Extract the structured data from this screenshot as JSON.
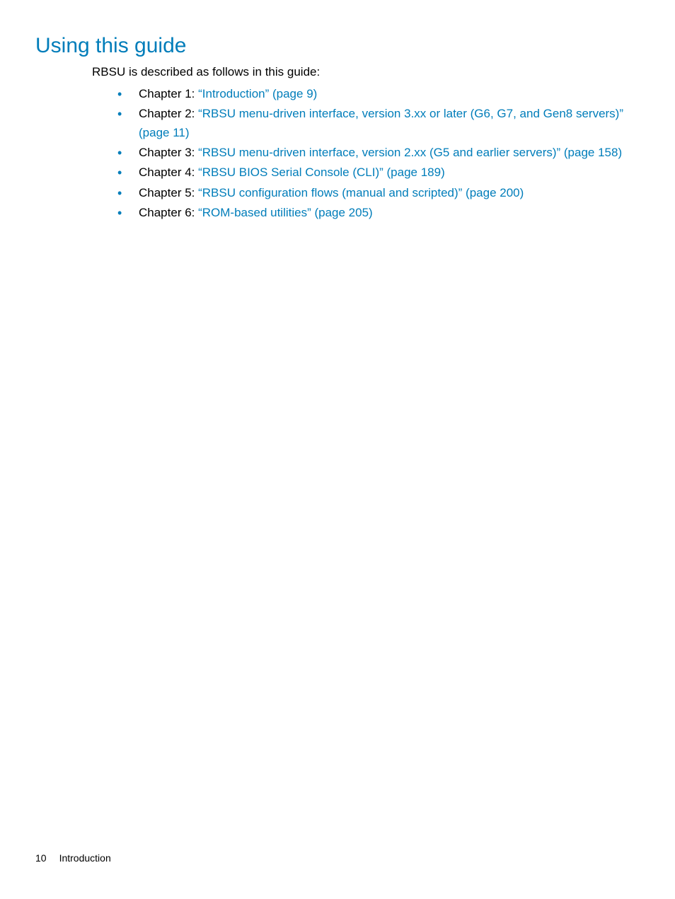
{
  "heading": "Using this guide",
  "intro": "RBSU is described as follows in this guide:",
  "chapters": [
    {
      "prefix": "Chapter 1: ",
      "link": "“Introduction” (page 9)"
    },
    {
      "prefix": "Chapter 2: ",
      "link": "“RBSU menu-driven interface, version 3.xx or later (G6, G7, and Gen8 servers)” (page 11)"
    },
    {
      "prefix": "Chapter 3: ",
      "link": "“RBSU menu-driven interface, version 2.xx (G5 and earlier servers)” (page 158)"
    },
    {
      "prefix": "Chapter 4: ",
      "link": "“RBSU BIOS Serial Console (CLI)” (page 189)"
    },
    {
      "prefix": "Chapter 5: ",
      "link": "“RBSU configuration flows (manual and scripted)” (page 200)"
    },
    {
      "prefix": "Chapter 6: ",
      "link": "“ROM-based utilities” (page 205)"
    }
  ],
  "footer": {
    "page": "10",
    "section": "Introduction"
  }
}
